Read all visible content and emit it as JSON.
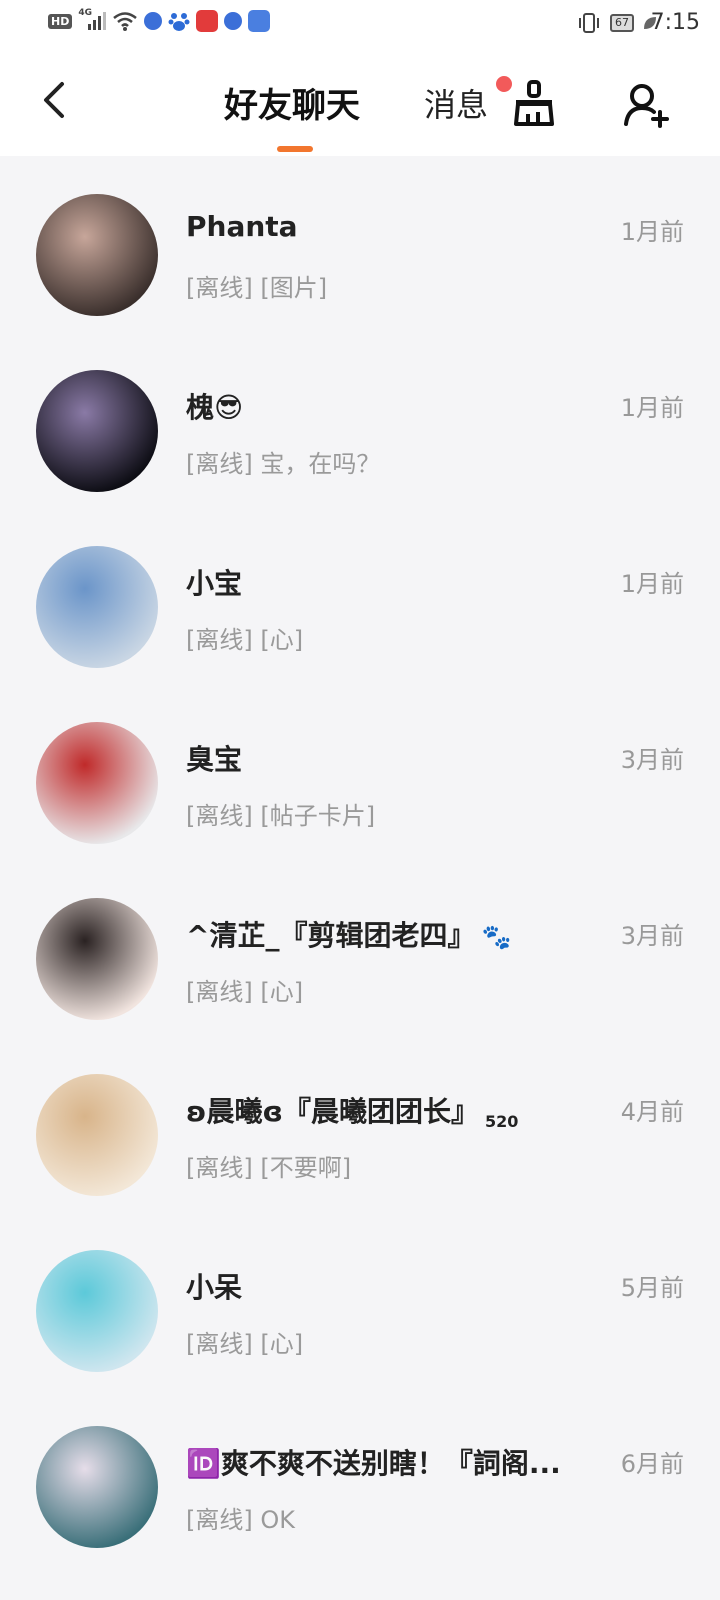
{
  "status_bar": {
    "hd": "HD",
    "network": "4G",
    "battery": "67",
    "time": "7:15",
    "icons": [
      "hd-icon",
      "signal-icon",
      "wifi-icon",
      "app-icon",
      "baidu-icon",
      "video-app-icon",
      "app-icon",
      "file-app-icon",
      "vibrate-icon",
      "battery-icon",
      "leaf-icon"
    ]
  },
  "header": {
    "back_icon": "chevron-left-icon",
    "active_tab": "好友聊天",
    "messages_tab": "消息",
    "accent": "#f2762e",
    "badge_color": "#f25a5a",
    "clean_icon": "broom-icon",
    "add_friend_icon": "add-user-icon"
  },
  "chats": [
    {
      "name": "Phanta",
      "time": "1月前",
      "status": "[离线]",
      "preview": "[图片]",
      "avatar_colors": [
        "#3a2f2c",
        "#c7a69a"
      ]
    },
    {
      "name": "槐😎",
      "time": "1月前",
      "status": "[离线]",
      "preview": "宝，在吗？",
      "avatar_colors": [
        "#0d0d14",
        "#8a7aa6"
      ]
    },
    {
      "name": "小宝",
      "time": "1月前",
      "status": "[离线]",
      "preview": "[心]",
      "avatar_colors": [
        "#c9d6e4",
        "#6b95c9"
      ]
    },
    {
      "name": "臭宝",
      "time": "3月前",
      "status": "[离线]",
      "preview": "[帖子卡片]",
      "avatar_colors": [
        "#e8e8ea",
        "#c02a2a"
      ]
    },
    {
      "name": "^清芷_『剪辑团老四』",
      "time": "3月前",
      "status": "[离线]",
      "preview": "[心]",
      "avatar_colors": [
        "#f1e4df",
        "#2a2222"
      ],
      "suffix_icon": "paw-icon"
    },
    {
      "name": "ʚ晨曦ɞ『晨曦团团长』",
      "time": "4月前",
      "status": "[离线]",
      "preview": "[不要啊]",
      "avatar_colors": [
        "#f3e7d7",
        "#d8b48a"
      ],
      "suffix_text": "520"
    },
    {
      "name": "小呆",
      "time": "5月前",
      "status": "[离线]",
      "preview": "[心]",
      "avatar_colors": [
        "#cfe6ef",
        "#5cc9d9"
      ]
    },
    {
      "name": "🆔爽不爽不送别瞎！『詞阁...",
      "time": "6月前",
      "status": "[离线]",
      "preview": "OK",
      "avatar_colors": [
        "#3a6f79",
        "#e6dde9"
      ]
    }
  ]
}
